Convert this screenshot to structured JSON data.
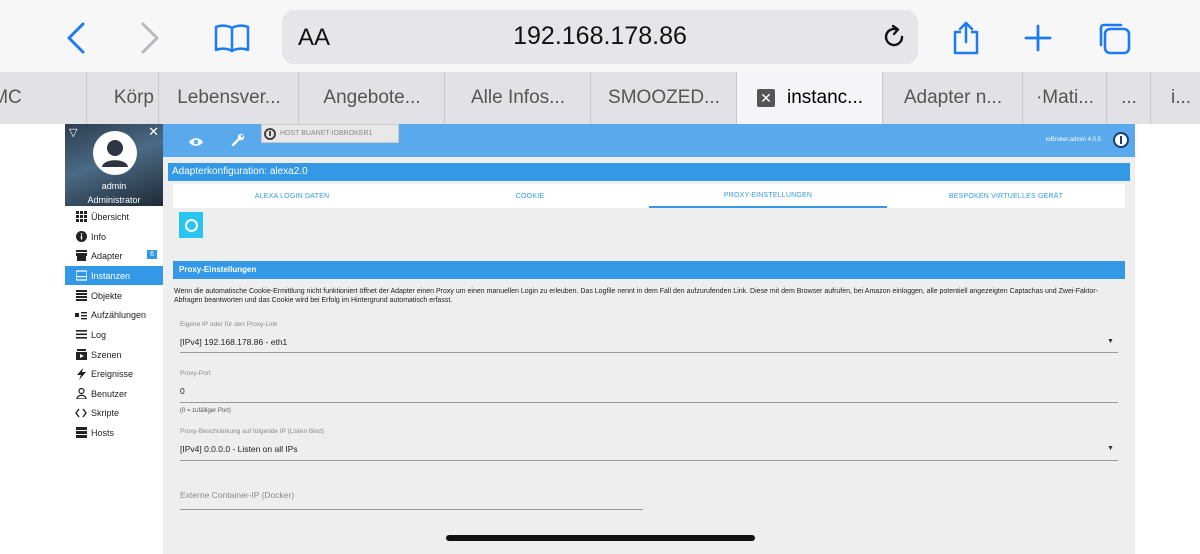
{
  "browser": {
    "address": "192.168.178.86",
    "text_size_label": "AA",
    "tabs": [
      {
        "label": "MC",
        "active": false
      },
      {
        "label": "Körp",
        "active": false
      },
      {
        "label": "Lebensver...",
        "active": false
      },
      {
        "label": "Angebote...",
        "active": false
      },
      {
        "label": "Alle Infos...",
        "active": false
      },
      {
        "label": "SMOOZED...",
        "active": false
      },
      {
        "label": "instanc...",
        "active": true
      },
      {
        "label": "Adapter n...",
        "active": false
      },
      {
        "label": "·Mati...",
        "active": false
      },
      {
        "label": "...",
        "active": false
      },
      {
        "label": "i...",
        "active": false
      }
    ]
  },
  "sidebar": {
    "user": "admin",
    "role": "Administrator",
    "items": [
      {
        "label": "Übersicht",
        "icon": "grid-icon"
      },
      {
        "label": "Info",
        "icon": "info-icon"
      },
      {
        "label": "Adapter",
        "icon": "store-icon",
        "badge": "6"
      },
      {
        "label": "Instanzen",
        "icon": "instances-icon",
        "active": true
      },
      {
        "label": "Objekte",
        "icon": "list-icon"
      },
      {
        "label": "Aufzählungen",
        "icon": "enum-icon"
      },
      {
        "label": "Log",
        "icon": "log-icon"
      },
      {
        "label": "Szenen",
        "icon": "scenes-icon"
      },
      {
        "label": "Ereignisse",
        "icon": "flash-icon"
      },
      {
        "label": "Benutzer",
        "icon": "user-icon"
      },
      {
        "label": "Skripte",
        "icon": "code-icon"
      },
      {
        "label": "Hosts",
        "icon": "hosts-icon"
      }
    ]
  },
  "header": {
    "host": "HOST BUANET-IOBROKER1",
    "version": "ioBroker.admin 4.0.5"
  },
  "config": {
    "title": "Adapterkonfiguration: alexa2.0",
    "tabs": [
      "ALEXA LOGIN DATEN",
      "COOKIE",
      "PROXY-EINSTELLUNGEN",
      "BESPOKEN VIRTUELLES GERÄT"
    ],
    "active_tab": 2,
    "section_title": "Proxy-Einstellungen",
    "description": "Wenn die automatische Cookie-Ermittlung nicht funktioniert öffnet der Adapter einen Proxy um einen manuellen Login zu erleuben. Das Logfile nennt in dem Fall den aufzurufenden Link. Diese mit dem Browser aufrufen, bei Amazon einloggen, alle potentiell angezeigten Captachas und Zwei-Faktor-Abfragen beantworten und das Cookie wird bei Erfolg im Hintergrund automatisch erfasst.",
    "fields": {
      "own_ip_label": "Eigene IP oder für den Proxy-Link",
      "own_ip_value": "[IPv4] 192.168.178.86 - eth1",
      "port_label": "Proxy-Port",
      "port_value": "0",
      "port_help": "(0 = zufälliger Port)",
      "bind_label": "Proxy-Beschränkung auf folgende IP (Listen Bind)",
      "bind_value": "[IPv4] 0.0.0.0 - Listen on all IPs",
      "docker_placeholder": "Externe Container-IP (Docker)"
    }
  },
  "colors": {
    "accent": "#3399e6",
    "topbar": "#5aa9ec",
    "safari_blue": "#1a7cf0"
  }
}
